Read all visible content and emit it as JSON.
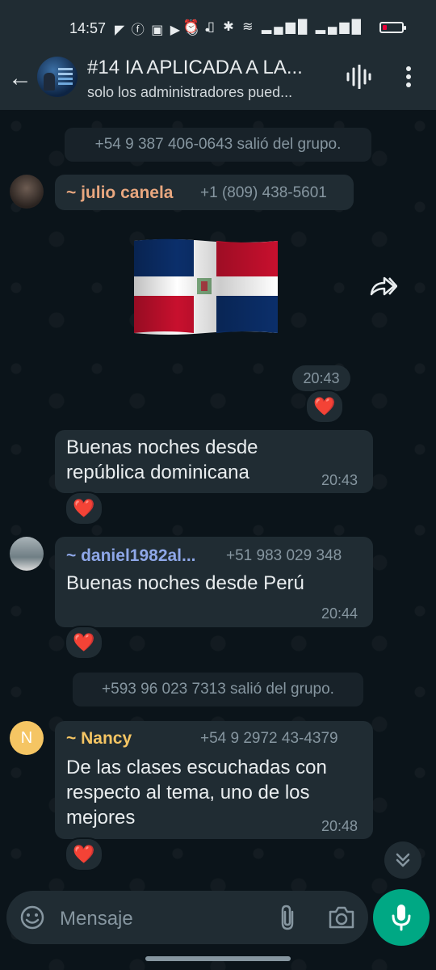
{
  "status_bar": {
    "time": "14:57",
    "left_icons": "◤ ⓕ ▣ ▶ ◉ •",
    "right_icons": "⏰ ▯ ✱ ≋ ▂▄▆█ ▂▄▆█"
  },
  "header": {
    "title": "#14 IA APLICADA A LA...",
    "subtitle": "solo los administradores pued..."
  },
  "messages": [
    {
      "type": "system",
      "text": "+54 9 387 406-0643 salió del grupo."
    },
    {
      "type": "sender_header",
      "sender": "~ julio canela",
      "phone": "+1 (809) 438-5601",
      "sender_color": "#e9a77f"
    },
    {
      "type": "sticker",
      "time": "20:43",
      "reaction": "❤️"
    },
    {
      "type": "text",
      "text": "Buenas noches desde república dominicana",
      "time": "20:43",
      "reaction": "❤️"
    },
    {
      "type": "text",
      "sender": "~ daniel1982al...",
      "phone": "+51 983 029 348",
      "sender_color": "#8ea7e8",
      "text": "Buenas noches desde Perú",
      "time": "20:44",
      "reaction": "❤️"
    },
    {
      "type": "system",
      "text": "+593 96 023 7313 salió del grupo."
    },
    {
      "type": "text",
      "sender": "~ Nancy",
      "phone": "+54 9 2972 43-4379",
      "sender_color": "#f5c563",
      "avatar_letter": "N",
      "text": "De las clases escuchadas con respecto al tema, uno de los mejores",
      "time": "20:48",
      "reaction": "❤️"
    }
  ],
  "input": {
    "placeholder": "Mensaje"
  },
  "colors": {
    "background": "#0b141a",
    "bubble": "#202c33",
    "accent": "#00a884"
  }
}
